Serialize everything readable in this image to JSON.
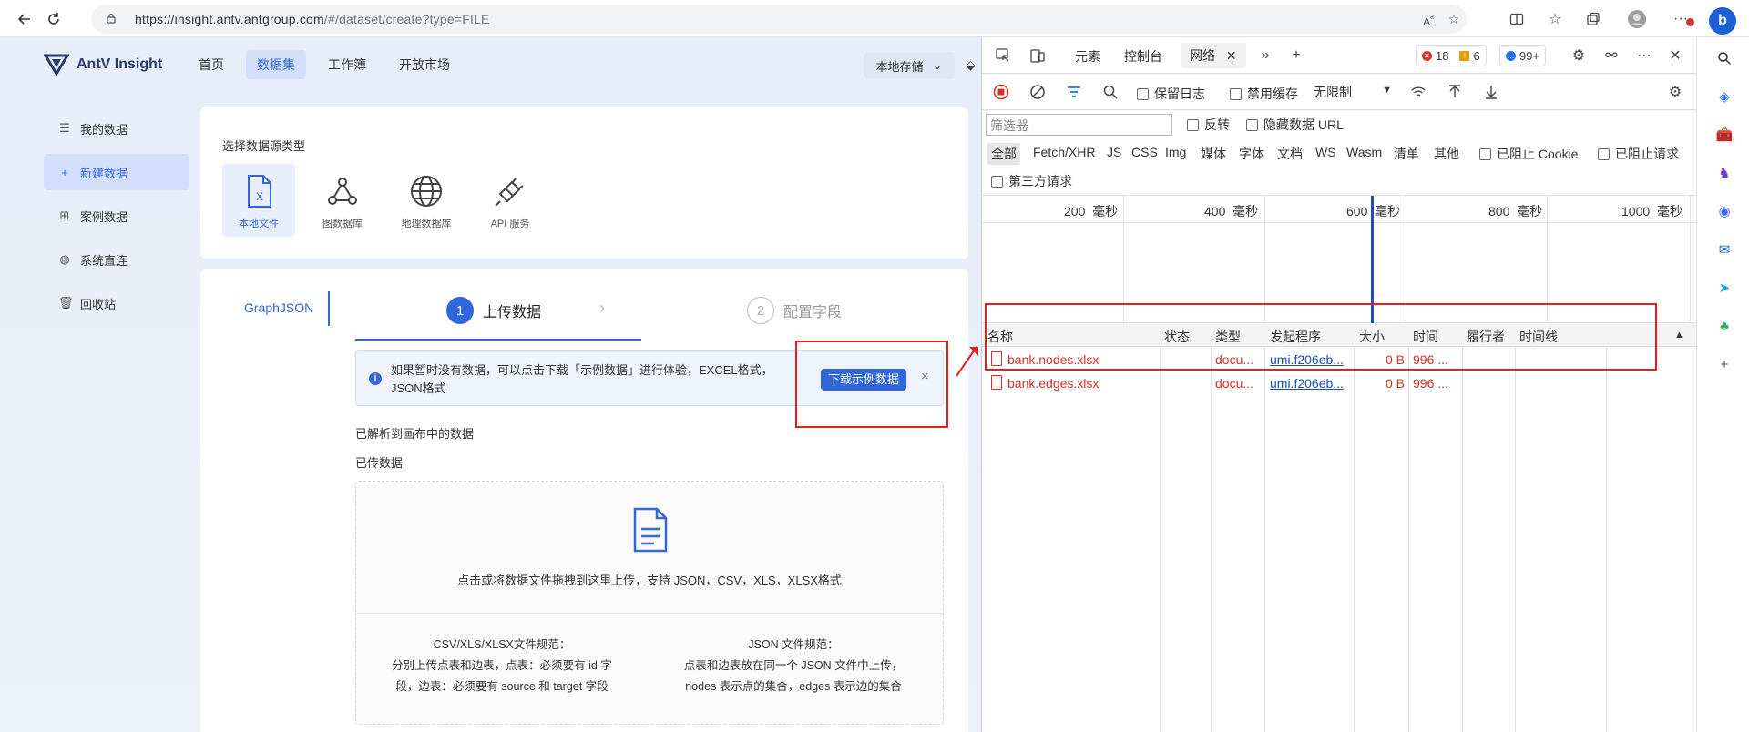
{
  "browser": {
    "url_host": "https://insight.antv.antgroup.com",
    "url_path": "/#/dataset/create?type=FILE"
  },
  "app": {
    "logo_text": "AntV Insight",
    "topnav": [
      {
        "label": "首页"
      },
      {
        "label": "数据集"
      },
      {
        "label": "工作簿"
      },
      {
        "label": "开放市场"
      }
    ],
    "storage_label": "本地存储",
    "sidenav": [
      {
        "label": "我的数据",
        "icon": "list-icon"
      },
      {
        "label": "新建数据",
        "icon": "plus-icon"
      },
      {
        "label": "案例数据",
        "icon": "grid-icon"
      },
      {
        "label": "系统直连",
        "icon": "globe-icon"
      },
      {
        "label": "回收站",
        "icon": "trash-icon"
      }
    ],
    "source_type_title": "选择数据源类型",
    "sources": [
      {
        "label": "本地文件",
        "icon": "file-x-icon"
      },
      {
        "label": "图数据库",
        "icon": "graph-db-icon"
      },
      {
        "label": "地理数据库",
        "icon": "globe-icon"
      },
      {
        "label": "API 服务",
        "icon": "plug-icon"
      }
    ],
    "format_tab": "GraphJSON",
    "steps": [
      {
        "num": "1",
        "label": "上传数据"
      },
      {
        "num": "2",
        "label": "配置字段"
      }
    ],
    "notice": {
      "text": "如果暂时没有数据，可以点击下载「示例数据」进行体验，EXCEL格式，JSON格式",
      "button": "下载示例数据"
    },
    "parsed_label": "已解析到画布中的数据",
    "uploaded_label": "已传数据",
    "dropzone": {
      "hint": "点击或将数据文件拖拽到这里上传，支持 JSON，CSV，XLS，XLSX格式",
      "rule_left_title": "CSV/XLS/XLSX文件规范：",
      "rule_left_body_1": "分别上传点表和边表，点表：必须要有 id 字",
      "rule_left_body_2": "段，边表：必须要有 source 和 target 字段",
      "rule_right_title": "JSON 文件规范：",
      "rule_right_body_1": "点表和边表放在同一个 JSON 文件中上传，",
      "rule_right_body_2": "nodes 表示点的集合，edges 表示边的集合"
    }
  },
  "devtools": {
    "tabs": [
      {
        "label": "元素"
      },
      {
        "label": "控制台"
      },
      {
        "label": "网络"
      }
    ],
    "errors": "18",
    "warnings": "6",
    "messages": "99+",
    "preserve_log": "保留日志",
    "disable_cache": "禁用缓存",
    "throttle": "无限制",
    "filter_placeholder": "筛选器",
    "invert": "反转",
    "hide_data_urls": "隐藏数据 URL",
    "types": [
      "全部",
      "Fetch/XHR",
      "JS",
      "CSS",
      "Img",
      "媒体",
      "字体",
      "文档",
      "WS",
      "Wasm",
      "清单",
      "其他"
    ],
    "blocked_cookies": "已阻止 Cookie",
    "blocked_requests": "已阻止请求",
    "third_party": "第三方请求",
    "timeline_ticks": [
      {
        "value": "200",
        "unit": "毫秒"
      },
      {
        "value": "400",
        "unit": "毫秒"
      },
      {
        "value": "600",
        "unit": "毫秒"
      },
      {
        "value": "800",
        "unit": "毫秒"
      },
      {
        "value": "1000",
        "unit": "毫秒"
      }
    ],
    "columns": [
      "名称",
      "状态",
      "类型",
      "发起程序",
      "大小",
      "时间",
      "履行者",
      "时间线"
    ],
    "rows": [
      {
        "name": "bank.nodes.xlsx",
        "status": "",
        "type": "docu...",
        "initiator": "umi.f206eb...",
        "size": "0 B",
        "time": "996 ..."
      },
      {
        "name": "bank.edges.xlsx",
        "status": "",
        "type": "docu...",
        "initiator": "umi.f206eb...",
        "size": "0 B",
        "time": "996 ..."
      }
    ]
  },
  "colors": {
    "accent": "#3366d9",
    "annotation_red": "#e81e1e",
    "error_text": "#d93026"
  }
}
